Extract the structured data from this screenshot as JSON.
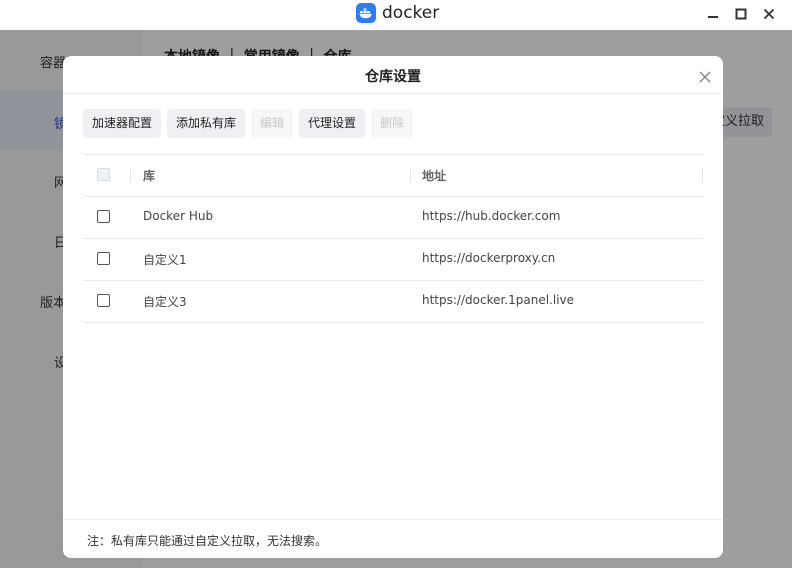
{
  "window": {
    "app_name": "docker"
  },
  "background": {
    "sidebar_items": [
      "容器管理",
      "镜",
      "网",
      "日",
      "版本",
      "设"
    ],
    "tabs": "本地镜像 ｜ 常用镜像 ｜ 仓库",
    "right_button": "定义拉取"
  },
  "dialog": {
    "title": "仓库设置",
    "toolbar": {
      "accelerator": "加速器配置",
      "add_private": "添加私有库",
      "edit": "编辑",
      "proxy": "代理设置",
      "delete": "删除"
    },
    "table": {
      "headers": {
        "name": "库",
        "address": "地址"
      },
      "rows": [
        {
          "name": "Docker Hub",
          "address": "https://hub.docker.com"
        },
        {
          "name": "自定义1",
          "address": "https://dockerproxy.cn"
        },
        {
          "name": "自定义3",
          "address": "https://docker.1panel.live"
        }
      ]
    },
    "note": "注：私有库只能通过自定义拉取，无法搜索。"
  },
  "colors": {
    "accent": "#2f7df6",
    "overlay": "rgba(0,0,0,0.38)"
  }
}
